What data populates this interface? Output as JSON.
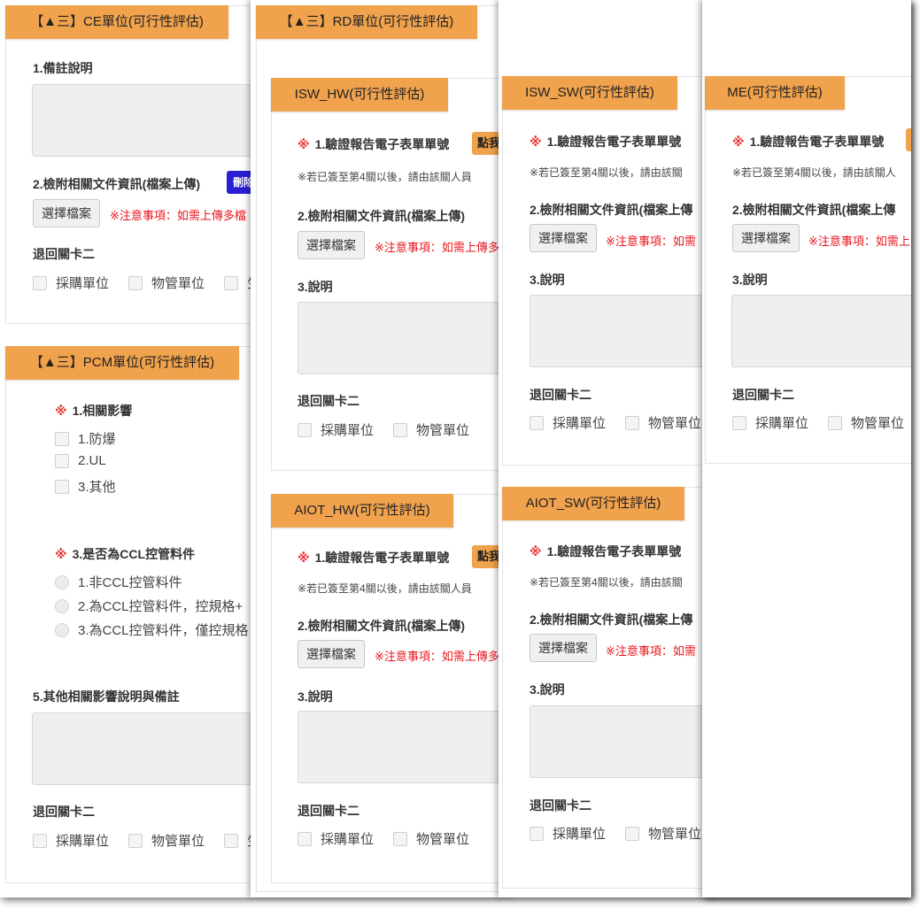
{
  "panel1": {
    "ce": {
      "tab": "【▲三】CE單位(可行性評估)",
      "remark_label": "1.備註說明",
      "attach_label": "2.檢附相關文件資訊(檔案上傳)",
      "delete_btn": "刪除",
      "choose_file": "選擇檔案",
      "warning": "※注意事項：如需上傳多檔",
      "return_label": "退回關卡二",
      "opt1": "採購單位",
      "opt2": "物管單位",
      "opt3": "生"
    },
    "pcm": {
      "tab": "【▲三】PCM單位(可行性評估)",
      "impact_label": "1.相關影響",
      "impact_opts": [
        "1.防爆",
        "2.UL",
        "3.其他"
      ],
      "ccl_label": "3.是否為CCL控管料件",
      "ccl_opts": [
        "1.非CCL控管料件",
        "2.為CCL控管料件，控規格+",
        "3.為CCL控管料件，僅控規格"
      ],
      "other_label": "5.其他相關影響說明與備註",
      "return_label": "退回關卡二",
      "opt1": "採購單位",
      "opt2": "物管單位",
      "opt3": "生"
    },
    "req_mark": "※"
  },
  "panel2": {
    "tab": "【▲三】RD單位(可行性評估)",
    "isw_hw": {
      "tab": "ISW_HW(可行性評估)",
      "form_label": "1.驗證報告電子表單單號",
      "click_btn": "點我",
      "note": "※若已簽至第4關以後，請由該關人員",
      "attach_label": "2.檢附相關文件資訊(檔案上傳)",
      "choose_file": "選擇檔案",
      "warning": "※注意事項：如需上傳多",
      "desc_label": "3.說明",
      "return_label": "退回關卡二",
      "opt1": "採購單位",
      "opt2": "物管單位"
    },
    "aiot_hw": {
      "tab": "AIOT_HW(可行性評估)",
      "form_label": "1.驗證報告電子表單單號",
      "click_btn": "點我",
      "note": "※若已簽至第4關以後，請由該關人員",
      "attach_label": "2.檢附相關文件資訊(檔案上傳)",
      "choose_file": "選擇檔案",
      "warning": "※注意事項：如需上傳多",
      "desc_label": "3.說明",
      "return_label": "退回關卡二",
      "opt1": "採購單位",
      "opt2": "物管單位"
    }
  },
  "panel3": {
    "isw_sw": {
      "tab": "ISW_SW(可行性評估)",
      "form_label": "1.驗證報告電子表單單號",
      "note": "※若已簽至第4關以後，請由該關",
      "attach_label": "2.檢附相關文件資訊(檔案上傳",
      "choose_file": "選擇檔案",
      "warning": "※注意事項：如需",
      "desc_label": "3.說明",
      "return_label": "退回關卡二",
      "opt1": "採購單位",
      "opt2": "物管單位"
    },
    "aiot_sw": {
      "tab": "AIOT_SW(可行性評估)",
      "form_label": "1.驗證報告電子表單單號",
      "note": "※若已簽至第4關以後，請由該關",
      "attach_label": "2.檢附相關文件資訊(檔案上傳",
      "choose_file": "選擇檔案",
      "warning": "※注意事項：如需",
      "desc_label": "3.說明",
      "return_label": "退回關卡二",
      "opt1": "採購單位",
      "opt2": "物管單位"
    }
  },
  "panel4": {
    "me": {
      "tab": "ME(可行性評估)",
      "form_label": "1.驗證報告電子表單單號",
      "note": "※若已簽至第4關以後，請由該關人",
      "attach_label": "2.檢附相關文件資訊(檔案上傳",
      "choose_file": "選擇檔案",
      "warning": "※注意事項：如需上",
      "desc_label": "3.說明",
      "return_label": "退回關卡二",
      "opt1": "採購單位",
      "opt2": "物管單位"
    }
  }
}
